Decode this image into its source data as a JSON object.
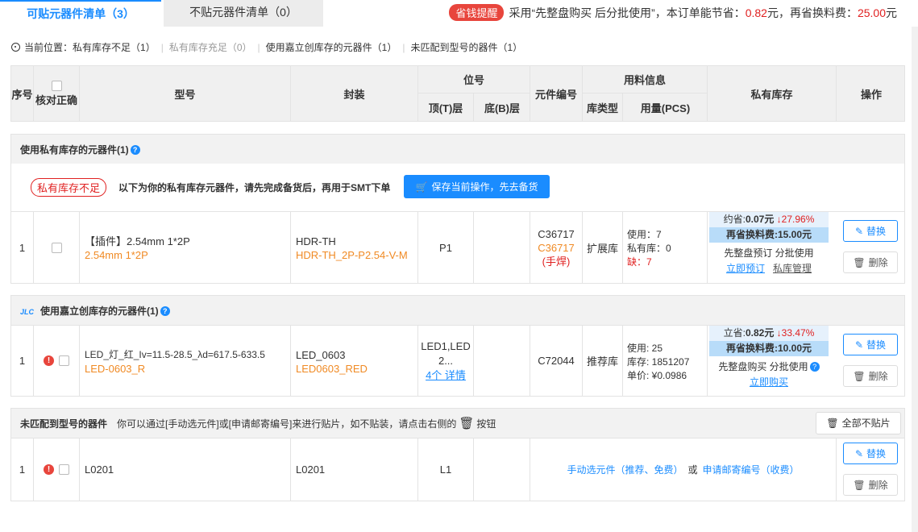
{
  "tabs": {
    "smt": "可贴元器件清单（3）",
    "non_smt": "不贴元器件清单（0）"
  },
  "tip": {
    "badge": "省钱提醒",
    "text1": "采用“先整盘购买 后分批使用”，本订单能节省：",
    "saving": "0.82",
    "unit1": "元，再省换料费：",
    "fee": "25.00",
    "unit2": "元"
  },
  "breadcrumb": {
    "label": "当前位置：",
    "items": [
      "私有库存不足（1）",
      "私有库存充足（0）",
      "使用嘉立创库存的元器件（1）",
      "未匹配到型号的器件（1）"
    ]
  },
  "header": {
    "no": "序号",
    "verify": "核对正确",
    "model": "型号",
    "package": "封装",
    "position": "位号",
    "top": "顶(T)层",
    "bottom": "底(B)层",
    "part_no": "元件编号",
    "material": "用料信息",
    "lib_type": "库类型",
    "qty": "用量(PCS)",
    "private_stock": "私有库存",
    "ops": "操作"
  },
  "sections": {
    "private": {
      "title": "使用私有库存的元器件(1)",
      "badge": "私有库存不足",
      "desc": "以下为你的私有库存元器件，请先完成备货后，再用于SMT下单",
      "button": "保存当前操作，先去备货"
    },
    "jlc": {
      "title": "使用嘉立创库存的元器件(1)",
      "logo": "JLC"
    },
    "unmatched": {
      "title": "未匹配到型号的器件",
      "desc": "你可以通过[手动选元件]或[申请邮寄编号]来进行贴片，如不贴装，请点击右侧的",
      "desc2": "按钮",
      "button": "全部不贴片"
    }
  },
  "rows": [
    {
      "no": "1",
      "model": "【插件】2.54mm 1*2P",
      "model_sub": "2.54mm 1*2P",
      "package": "HDR-TH",
      "package_sub": "HDR-TH_2P-P2.54-V-M",
      "top": "P1",
      "part_no": "C36717",
      "part_sub": "C36717",
      "part_note": "(手焊)",
      "lib": "扩展库",
      "use": "使用：7",
      "private": "私有库：0",
      "short": "缺：7",
      "save": "约省:",
      "save_val": "0.07元",
      "pct": "↓27.96%",
      "fee": "再省换料费:15.00元",
      "opt": "先整盘预订 分批使用",
      "link1": "立即预订",
      "link2": "私库管理",
      "replace": "替换",
      "delete": "删除"
    },
    {
      "no": "1",
      "model": "LED_灯_红_Iv=11.5-28.5_λd=617.5-633.5",
      "model_sub": "LED-0603_R",
      "package": "LED_0603",
      "package_sub": "LED0603_RED",
      "top": "LED1,LED 2...",
      "top_link": "4个 详情",
      "part_no": "C72044",
      "lib": "推荐库",
      "use": "使用:  25",
      "stock": "库存:  1851207",
      "price": "单价:  ¥0.0986",
      "save": "立省:",
      "save_val": "0.82元",
      "pct": "↓33.47%",
      "fee": "再省换料费:10.00元",
      "opt": "先整盘购买 分批使用",
      "link1": "立即购买",
      "replace": "替换",
      "delete": "删除"
    },
    {
      "no": "1",
      "model": "L0201",
      "package": "L0201",
      "top": "L1",
      "manual": "手动选元件（推荐、免费）",
      "or": "或",
      "apply": "申请邮寄编号（收费）",
      "replace": "替换",
      "delete": "删除"
    }
  ]
}
